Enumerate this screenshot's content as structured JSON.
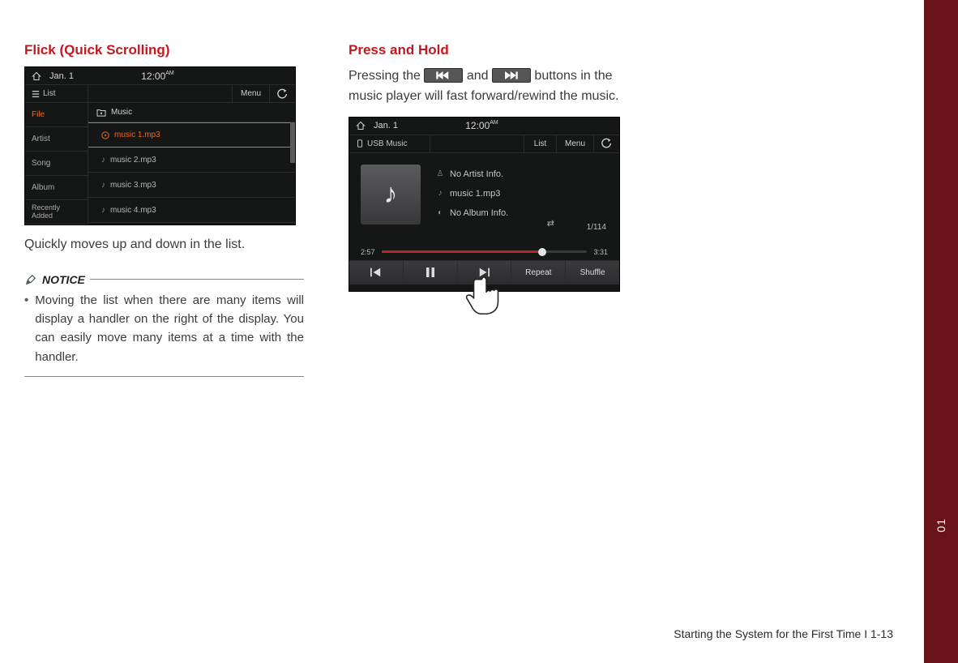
{
  "sections": {
    "flick": {
      "heading": "Flick (Quick Scrolling)",
      "body": "Quickly moves up and down in the list."
    },
    "press_hold": {
      "heading": "Press and Hold",
      "pre": "Pressing the ",
      "mid": " and ",
      "post": " buttons in the music player will fast forward/rewind the music."
    }
  },
  "notice": {
    "label": "NOTICE",
    "item": "Moving the list when there are many items will display a handler on the right of the display. You can easily move many items at a time with the handler."
  },
  "shot1": {
    "date": "Jan.  1",
    "time": "12:00",
    "ampm": "AM",
    "list_label": "List",
    "menu": "Menu",
    "categories": [
      "File",
      "Artist",
      "Song",
      "Album",
      "Recently\nAdded"
    ],
    "folder": "Music",
    "rows": [
      "music 1.mp3",
      "music 2.mp3",
      "music 3.mp3",
      "music 4.mp3"
    ]
  },
  "shot2": {
    "date": "Jan.  1",
    "time": "12:00",
    "ampm": "AM",
    "source": "USB Music",
    "list_btn": "List",
    "menu": "Menu",
    "artist": "No Artist Info.",
    "title": "music 1.mp3",
    "album": "No Album Info.",
    "count": "1/114",
    "elapsed": "2:57",
    "total": "3:31",
    "repeat": "Repeat",
    "shuffle": "Shuffle"
  },
  "footer": "Starting the System for the First Time I 1-13",
  "sidebar_num": "01"
}
